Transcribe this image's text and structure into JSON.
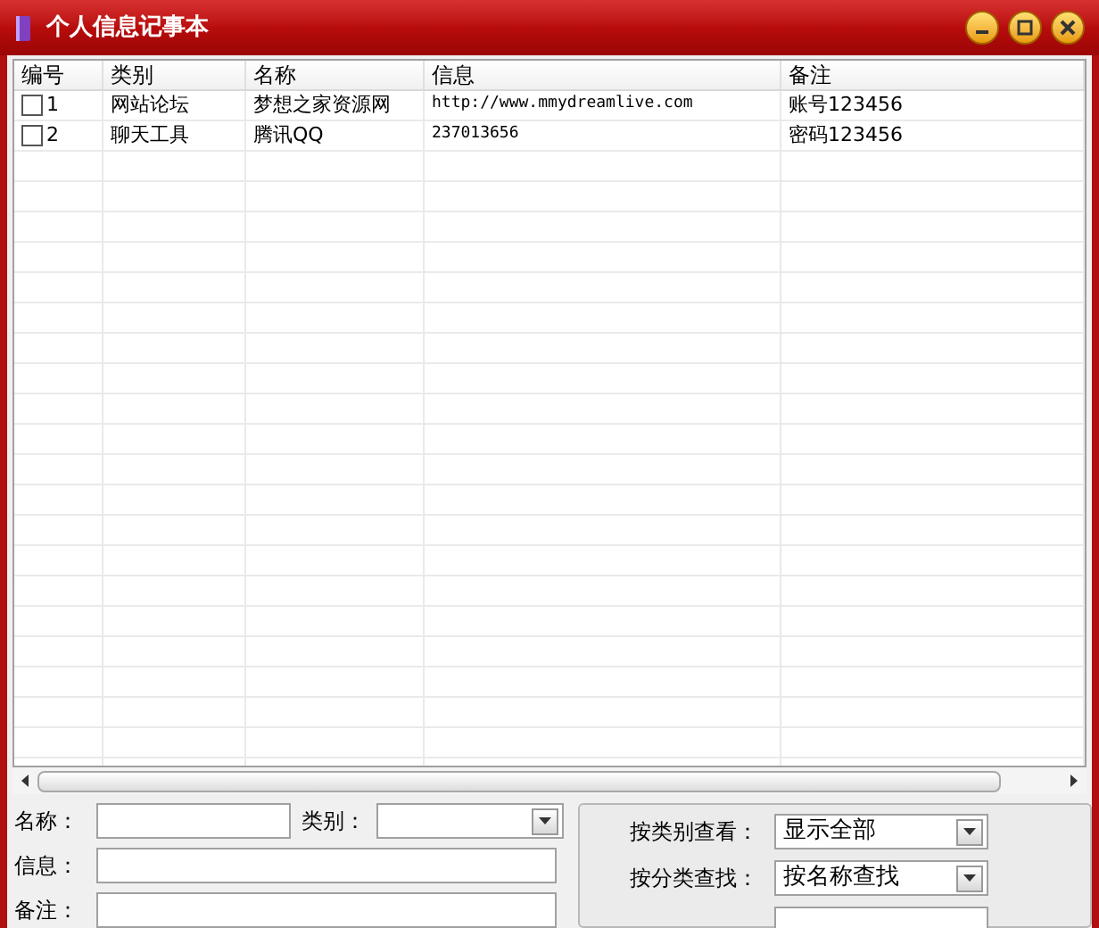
{
  "window": {
    "title": "个人信息记事本"
  },
  "table": {
    "columns": [
      "编号",
      "类别",
      "名称",
      "信息",
      "备注"
    ],
    "rows": [
      {
        "checked": false,
        "cells": [
          "1",
          "网站论坛",
          "梦想之家资源网",
          "http://www.mmydreamlive.com",
          "账号123456"
        ]
      },
      {
        "checked": false,
        "cells": [
          "2",
          "聊天工具",
          "腾讯QQ",
          "237013656",
          "密码123456"
        ]
      }
    ]
  },
  "form": {
    "name_label": "名称：",
    "category_label": "类别：",
    "info_label": "信息：",
    "note_label": "备注："
  },
  "filter": {
    "view_label": "按类别查看：",
    "view_value": "显示全部",
    "search_label": "按分类查找：",
    "search_value": "按名称查找"
  }
}
